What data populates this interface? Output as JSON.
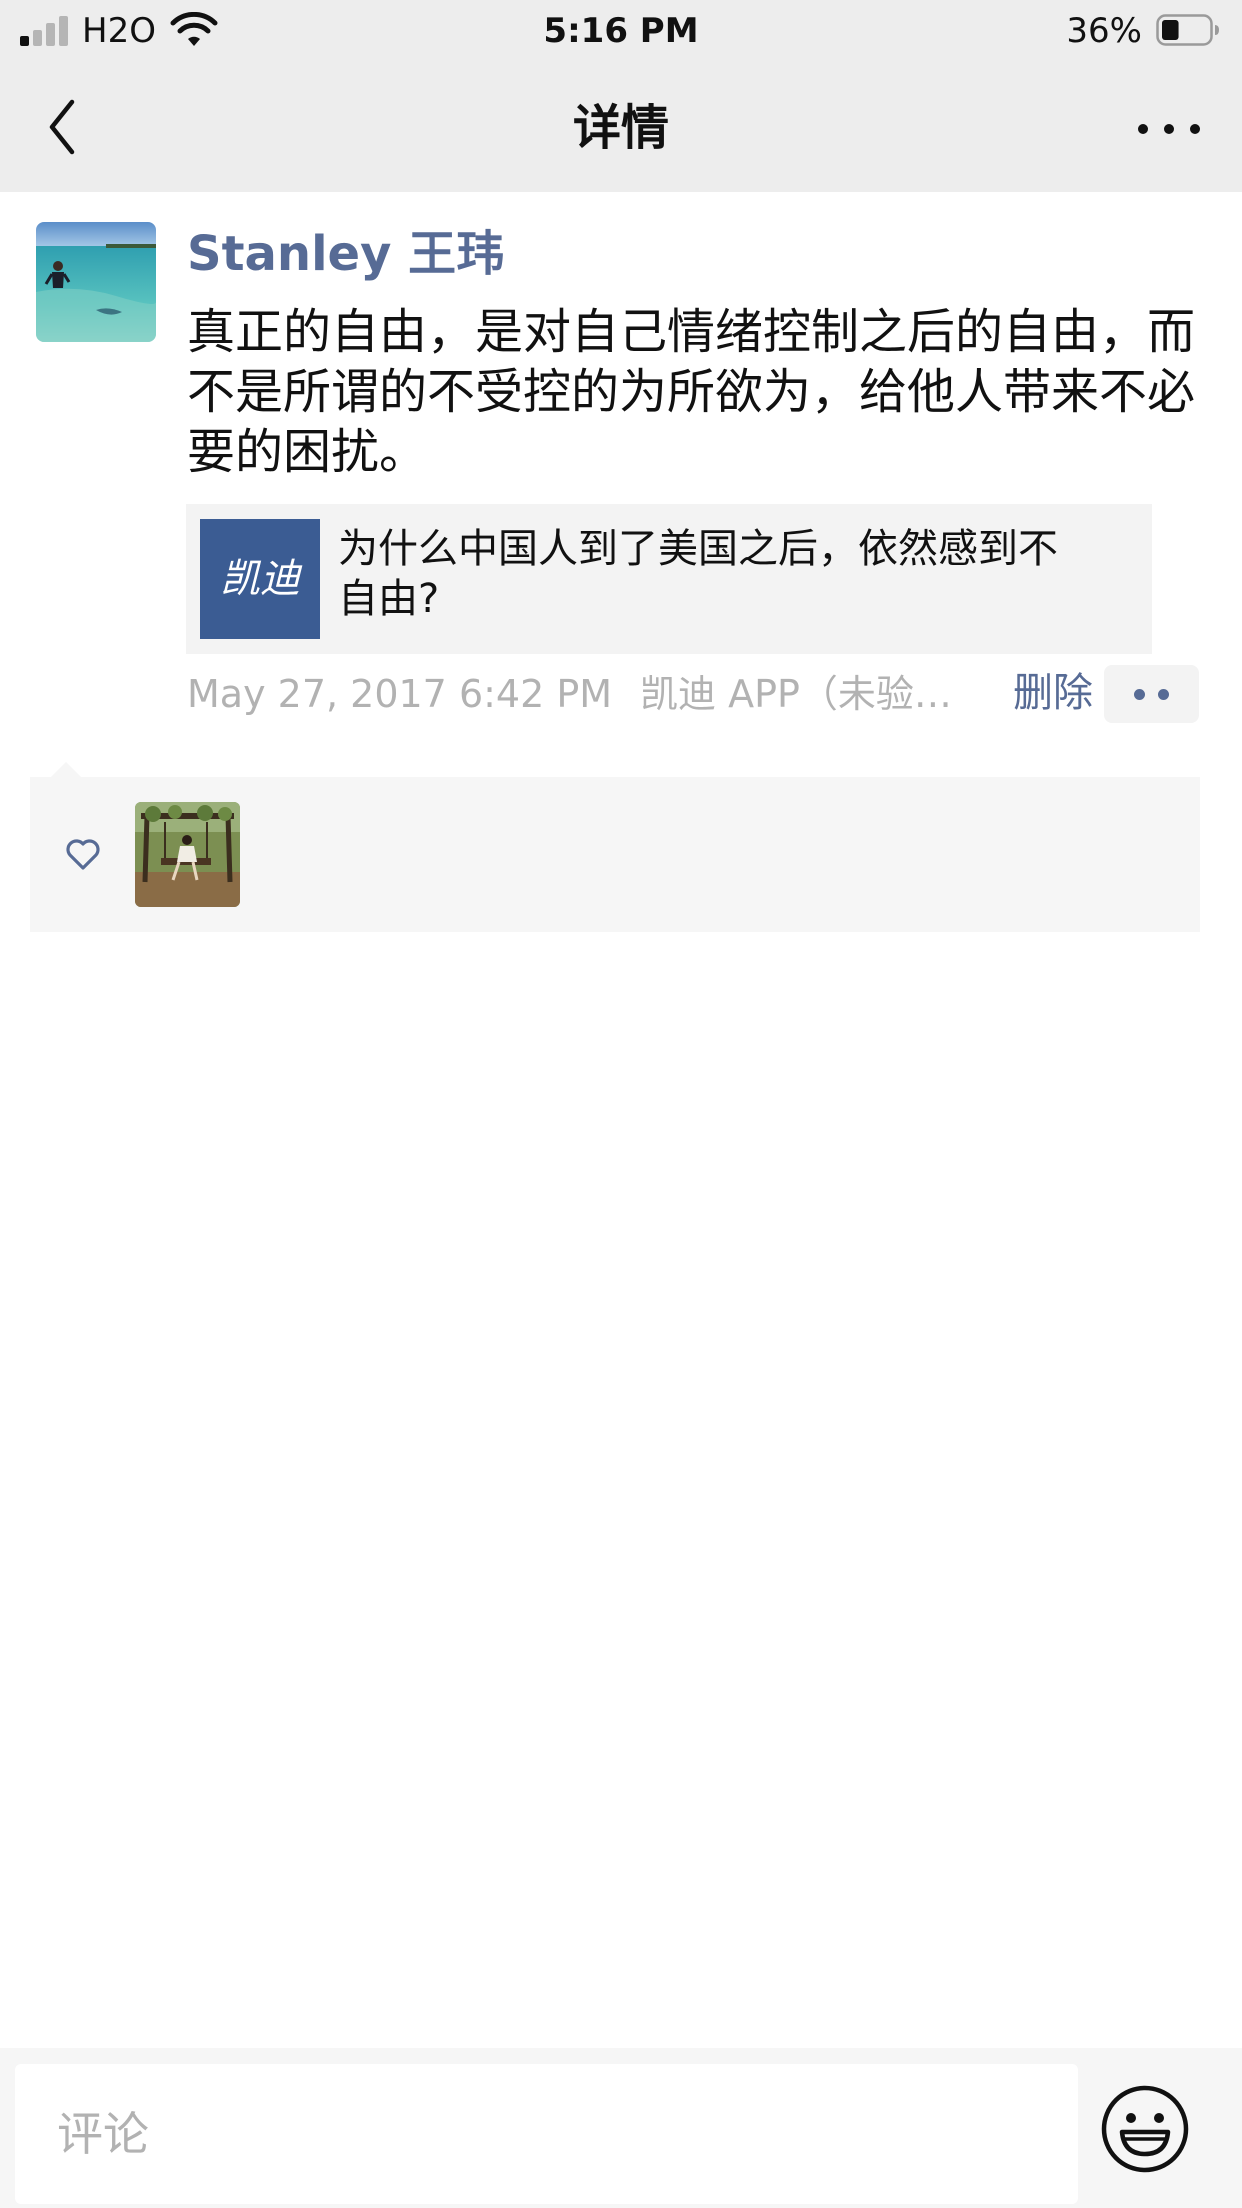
{
  "status_bar": {
    "carrier": "H2O",
    "time": "5:16 PM",
    "battery_percent": "36%",
    "battery_level": 0.36,
    "signal_bars_active": 1,
    "signal_bars_total": 4,
    "icons": [
      "signal-icon",
      "wifi-icon",
      "battery-icon"
    ]
  },
  "nav": {
    "title": "详情",
    "back_icon": "chevron-left-icon",
    "more_icon": "more-horizontal-icon"
  },
  "post": {
    "author": "Stanley 王玮",
    "text": "真正的自由，是对自己情绪控制之后的自由，而不是所谓的不受控的为所欲为，给他人带来不必要的困扰。",
    "link": {
      "thumb_text": "凯迪",
      "title": "为什么中国人到了美国之后，依然感到不自由?"
    },
    "time": "May 27, 2017 6:42 PM",
    "source": "凯迪 APP（未验…",
    "delete_label": "删除",
    "action_icon": "more-dots-icon"
  },
  "likes": {
    "icon": "heart-outline-icon",
    "count_avatars": 1
  },
  "comment_bar": {
    "placeholder": "评论",
    "value": "",
    "emoji_icon": "smiley-icon"
  },
  "colors": {
    "link_blue": "#576b95",
    "gray_text": "#b2b2b2",
    "nav_background": "#ededed",
    "panel_background": "#f6f6f6",
    "link_thumb": "#3b5c93"
  }
}
